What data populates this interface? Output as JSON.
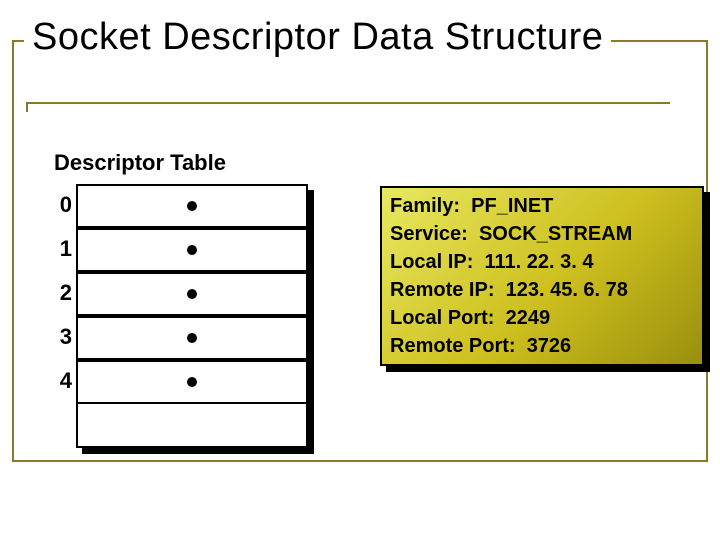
{
  "title": "Socket Descriptor Data Structure",
  "subtitle": "Descriptor Table",
  "descriptor_indices": [
    "0",
    "1",
    "2",
    "3",
    "4"
  ],
  "struct": {
    "fields": [
      {
        "label": "Family",
        "value": "PF_INET"
      },
      {
        "label": "Service",
        "value": "SOCK_STREAM"
      },
      {
        "label": "Local IP",
        "value": "111. 22. 3. 4"
      },
      {
        "label": "Remote IP",
        "value": "123. 45. 6. 78"
      },
      {
        "label": "Local Port",
        "value": "2249"
      },
      {
        "label": "Remote Port",
        "value": "3726"
      }
    ]
  },
  "colors": {
    "frame": "#8b7a2a",
    "gradient_start": "#e8e860",
    "gradient_mid": "#cdbf1e",
    "gradient_end": "#9a8f0e"
  }
}
